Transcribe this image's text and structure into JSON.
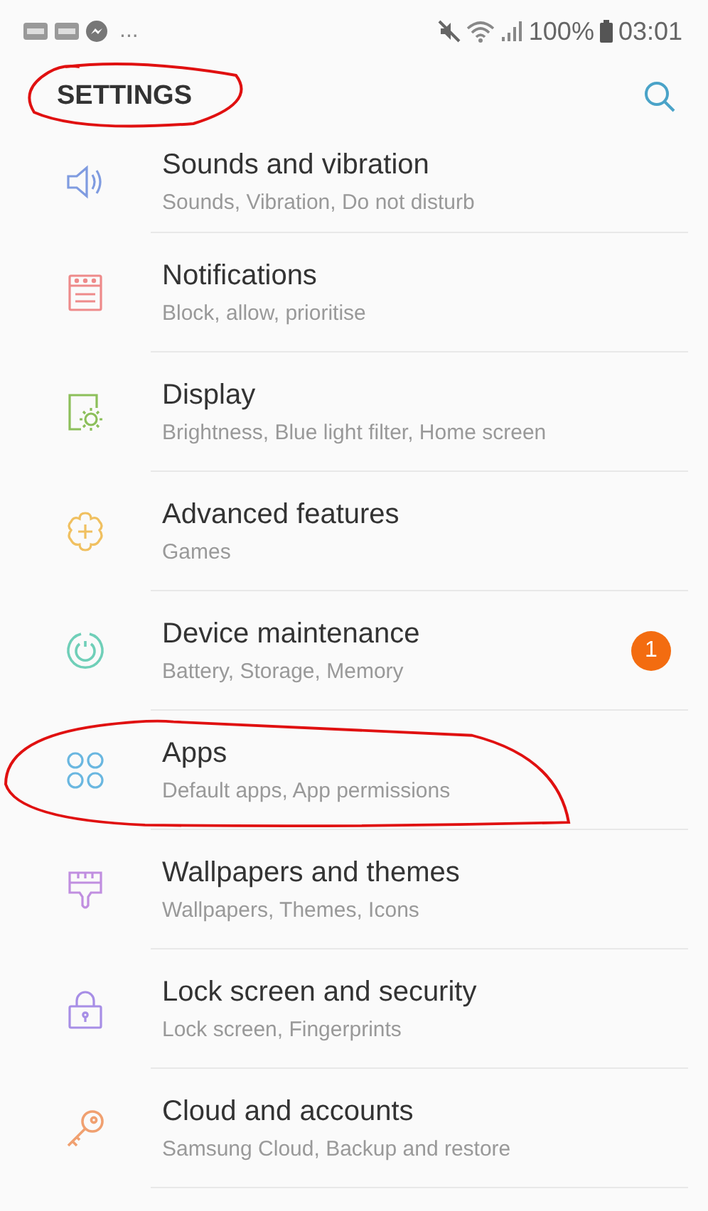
{
  "status_bar": {
    "more": "...",
    "battery": "100%",
    "time": "03:01"
  },
  "header": {
    "title": "SETTINGS",
    "circled": true
  },
  "items": [
    {
      "kind": "sound",
      "color": "#7f9be0",
      "title": "Sounds and vibration",
      "subtitle": "Sounds, Vibration, Do not disturb",
      "circled": false
    },
    {
      "kind": "notifications",
      "color": "#ee8a8a",
      "title": "Notifications",
      "subtitle": "Block, allow, prioritise",
      "circled": false
    },
    {
      "kind": "display",
      "color": "#8cbf5a",
      "title": "Display",
      "subtitle": "Brightness, Blue light filter, Home screen",
      "circled": false
    },
    {
      "kind": "advanced",
      "color": "#f0c060",
      "title": "Advanced features",
      "subtitle": "Games",
      "circled": false
    },
    {
      "kind": "maintenance",
      "color": "#6fcfb8",
      "title": "Device maintenance",
      "subtitle": "Battery, Storage, Memory",
      "badge": "1",
      "circled": false
    },
    {
      "kind": "apps",
      "color": "#6ab7e0",
      "title": "Apps",
      "subtitle": "Default apps, App permissions",
      "circled": true
    },
    {
      "kind": "wallpaper",
      "color": "#c08ee0",
      "title": "Wallpapers and themes",
      "subtitle": "Wallpapers, Themes, Icons",
      "circled": false
    },
    {
      "kind": "lock",
      "color": "#a78ee6",
      "title": "Lock screen and security",
      "subtitle": "Lock screen, Fingerprints",
      "circled": false
    },
    {
      "kind": "key",
      "color": "#f0a070",
      "title": "Cloud and accounts",
      "subtitle": "Samsung Cloud, Backup and restore",
      "circled": false
    }
  ]
}
